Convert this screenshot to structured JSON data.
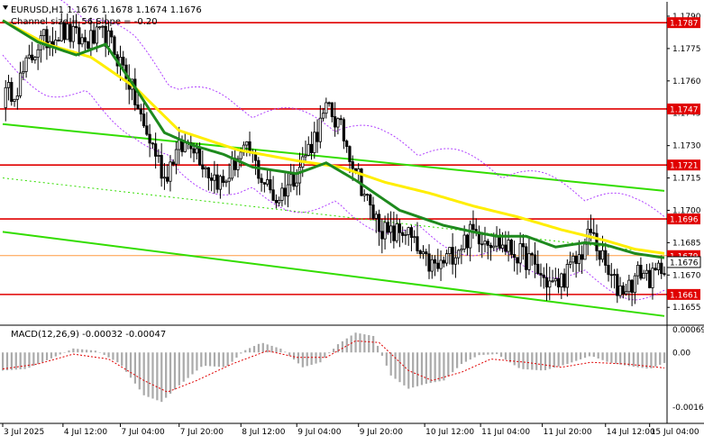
{
  "header": {
    "symbol_line": "EURUSD,H1  1.1676 1.1678 1.1674 1.1676",
    "indicator_line": "Channel size = 56 Slope = -0.20"
  },
  "macd_label": "MACD(12,26,9) -0.00032 -0.00047",
  "colors": {
    "level_line": "#e00000",
    "channel": "#33dd00",
    "ma_fast": "#1e8a1e",
    "ma_slow": "#ffee00",
    "bollinger": "#b040ff",
    "candle": "#000000",
    "price_tag_bg": "#e00000",
    "current_price_bg": "#ffffff",
    "macd_hist": "#aaaaaa",
    "macd_signal": "#e00000"
  },
  "chart_data": [
    {
      "type": "candlestick",
      "symbol": "EURUSD",
      "timeframe": "H1",
      "ylim": [
        1.1648,
        1.1795
      ],
      "y_ticks": [
        1.179,
        1.1775,
        1.176,
        1.1745,
        1.173,
        1.1715,
        1.17,
        1.1685,
        1.167,
        1.1655
      ],
      "x_ticks": [
        "3 Jul 2025",
        "4 Jul 12:00",
        "7 Jul 04:00",
        "7 Jul 20:00",
        "8 Jul 12:00",
        "9 Jul 04:00",
        "9 Jul 20:00",
        "10 Jul 12:00",
        "11 Jul 04:00",
        "11 Jul 20:00",
        "14 Jul 12:00",
        "15 Jul 04:00"
      ],
      "levels": [
        1.1787,
        1.1747,
        1.1721,
        1.1696,
        1.1661
      ],
      "current_price": 1.1676,
      "reference_price": 1.1679,
      "close_path": [
        [
          0,
          1.1752
        ],
        [
          5,
          1.1758
        ],
        [
          12,
          1.1777
        ],
        [
          20,
          1.1783
        ],
        [
          28,
          1.1778
        ],
        [
          35,
          1.1781
        ],
        [
          42,
          1.1764
        ],
        [
          48,
          1.1738
        ],
        [
          52,
          1.1727
        ],
        [
          55,
          1.1715
        ],
        [
          58,
          1.1725
        ],
        [
          64,
          1.1733
        ],
        [
          70,
          1.1718
        ],
        [
          75,
          1.1712
        ],
        [
          80,
          1.1725
        ],
        [
          84,
          1.1727
        ],
        [
          88,
          1.1715
        ],
        [
          93,
          1.1705
        ],
        [
          100,
          1.1718
        ],
        [
          106,
          1.1734
        ],
        [
          111,
          1.1748
        ],
        [
          116,
          1.1734
        ],
        [
          120,
          1.172
        ],
        [
          125,
          1.17
        ],
        [
          131,
          1.1688
        ],
        [
          137,
          1.1691
        ],
        [
          143,
          1.1676
        ],
        [
          148,
          1.1673
        ],
        [
          154,
          1.1682
        ],
        [
          160,
          1.169
        ],
        [
          166,
          1.1687
        ],
        [
          172,
          1.1682
        ],
        [
          179,
          1.1677
        ],
        [
          184,
          1.1668
        ],
        [
          188,
          1.1665
        ],
        [
          192,
          1.1671
        ],
        [
          196,
          1.1678
        ],
        [
          200,
          1.169
        ],
        [
          203,
          1.168
        ],
        [
          206,
          1.167
        ],
        [
          209,
          1.1664
        ],
        [
          213,
          1.1665
        ],
        [
          217,
          1.1672
        ],
        [
          221,
          1.1668
        ],
        [
          225,
          1.1676
        ]
      ],
      "ma_slow_path": [
        [
          0,
          1.1788
        ],
        [
          15,
          1.1777
        ],
        [
          30,
          1.1771
        ],
        [
          45,
          1.1757
        ],
        [
          60,
          1.1737
        ],
        [
          80,
          1.1728
        ],
        [
          100,
          1.1723
        ],
        [
          115,
          1.172
        ],
        [
          130,
          1.1713
        ],
        [
          145,
          1.1708
        ],
        [
          160,
          1.1702
        ],
        [
          175,
          1.1697
        ],
        [
          190,
          1.1691
        ],
        [
          205,
          1.1686
        ],
        [
          215,
          1.1682
        ],
        [
          225,
          1.168
        ]
      ],
      "ma_fast_path": [
        [
          0,
          1.1788
        ],
        [
          12,
          1.1778
        ],
        [
          25,
          1.1772
        ],
        [
          35,
          1.1777
        ],
        [
          45,
          1.1757
        ],
        [
          55,
          1.1736
        ],
        [
          65,
          1.173
        ],
        [
          75,
          1.1726
        ],
        [
          85,
          1.172
        ],
        [
          100,
          1.1717
        ],
        [
          110,
          1.1722
        ],
        [
          120,
          1.1714
        ],
        [
          135,
          1.17
        ],
        [
          150,
          1.1693
        ],
        [
          160,
          1.169
        ],
        [
          168,
          1.1688
        ],
        [
          178,
          1.1688
        ],
        [
          188,
          1.1683
        ],
        [
          198,
          1.1685
        ],
        [
          205,
          1.1684
        ],
        [
          215,
          1.168
        ],
        [
          225,
          1.1678
        ]
      ],
      "channel_upper": [
        [
          0,
          1.174
        ],
        [
          225,
          1.1709
        ]
      ],
      "channel_lower": [
        [
          0,
          1.169
        ],
        [
          225,
          1.1651
        ]
      ],
      "channel_mid": [
        [
          0,
          1.1715
        ],
        [
          225,
          1.168
        ]
      ]
    },
    {
      "type": "macd",
      "params": "12,26,9",
      "macd": -0.00032,
      "signal": -0.00047,
      "ylim": [
        -0.00166,
        0.00069
      ],
      "y_ticks": [
        0.00069,
        0.0,
        -0.00166
      ],
      "histogram_path": [
        [
          0,
          -0.00055
        ],
        [
          8,
          -0.0005
        ],
        [
          16,
          -0.0002
        ],
        [
          24,
          0.00012
        ],
        [
          32,
          5e-05
        ],
        [
          40,
          -0.00035
        ],
        [
          48,
          -0.0013
        ],
        [
          54,
          -0.0015
        ],
        [
          60,
          -0.001
        ],
        [
          68,
          -0.0004
        ],
        [
          76,
          -0.00045
        ],
        [
          82,
          5e-05
        ],
        [
          88,
          0.0003
        ],
        [
          95,
          0.0001
        ],
        [
          102,
          -0.00045
        ],
        [
          108,
          -0.0003
        ],
        [
          114,
          0.00025
        ],
        [
          120,
          0.0006
        ],
        [
          126,
          0.0005
        ],
        [
          132,
          -0.0007
        ],
        [
          138,
          -0.0011
        ],
        [
          144,
          -0.00095
        ],
        [
          150,
          -0.00085
        ],
        [
          156,
          -0.00035
        ],
        [
          162,
          -8e-05
        ],
        [
          168,
          -5e-05
        ],
        [
          176,
          -0.0005
        ],
        [
          184,
          -0.00055
        ],
        [
          192,
          -0.00035
        ],
        [
          200,
          -0.0001
        ],
        [
          206,
          -0.0003
        ],
        [
          212,
          -0.0004
        ],
        [
          220,
          -0.0005
        ],
        [
          225,
          -0.00032
        ]
      ],
      "signal_path": [
        [
          0,
          -0.0005
        ],
        [
          12,
          -0.00035
        ],
        [
          24,
          -5e-05
        ],
        [
          36,
          -0.0002
        ],
        [
          48,
          -0.00085
        ],
        [
          56,
          -0.0012
        ],
        [
          66,
          -0.00085
        ],
        [
          78,
          -0.00035
        ],
        [
          90,
          5e-05
        ],
        [
          100,
          -0.00015
        ],
        [
          110,
          -0.00015
        ],
        [
          120,
          0.00035
        ],
        [
          128,
          0.0003
        ],
        [
          138,
          -0.00055
        ],
        [
          146,
          -0.00085
        ],
        [
          156,
          -0.0006
        ],
        [
          166,
          -0.0002
        ],
        [
          178,
          -0.0003
        ],
        [
          190,
          -0.00045
        ],
        [
          200,
          -0.0003
        ],
        [
          212,
          -0.00035
        ],
        [
          225,
          -0.00047
        ]
      ]
    }
  ]
}
